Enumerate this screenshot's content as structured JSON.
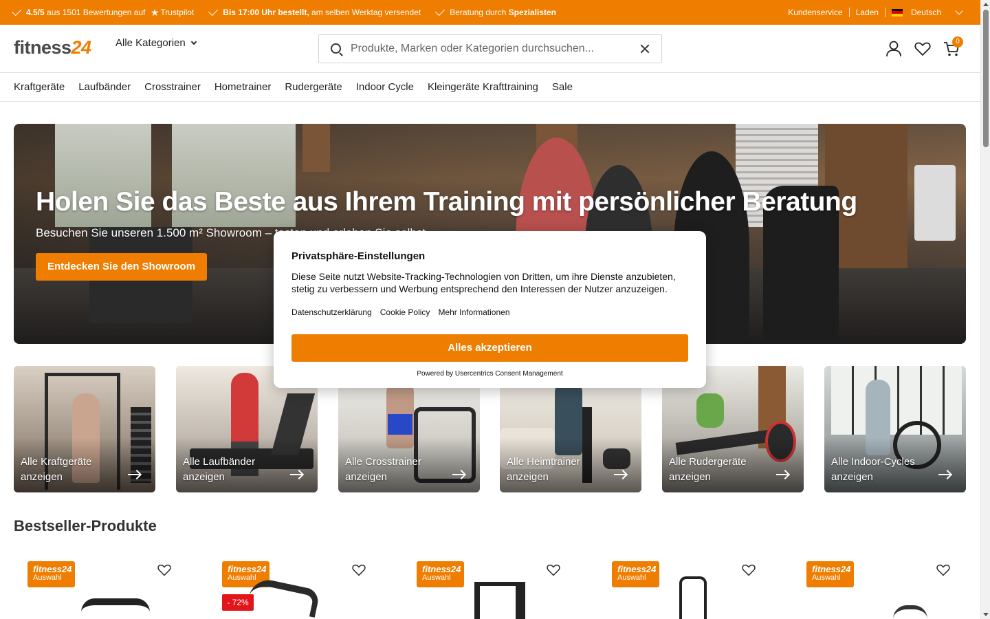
{
  "topbar": {
    "rating_bold": "4.5/5",
    "rating_text": " aus 1501 Bewertungen auf ",
    "rating_brand": "Trustpilot",
    "shipping_bold": "Bis 17:00 Uhr bestellt,",
    "shipping_text": " am selben Werktag versendet",
    "advice_text": "Beratung durch ",
    "advice_bold": "Spezialisten",
    "customer_service": "Kundenservice",
    "store": "Laden",
    "language": "Deutsch"
  },
  "header": {
    "logo_text": "fitness",
    "logo_number": "24",
    "all_categories": "Alle Kategorien",
    "search_placeholder": "Produkte, Marken oder Kategorien durchsuchen...",
    "cart_count": "0"
  },
  "nav": {
    "items": [
      "Kraftgeräte",
      "Laufbänder",
      "Crosstrainer",
      "Hometrainer",
      "Rudergeräte",
      "Indoor Cycle",
      "Kleingeräte Krafttraining",
      "Sale"
    ]
  },
  "hero": {
    "title": "Holen Sie das Beste aus Ihrem Training mit persönlicher Beratung",
    "subtitle": "Besuchen Sie unseren 1.500 m² Showroom – testen und erleben Sie selbst",
    "cta": "Entdecken Sie den Showroom"
  },
  "categories": [
    {
      "label": "Alle Kraftgeräte anzeigen",
      "bg": "#8c7a66"
    },
    {
      "label": "Alle Laufbänder anzeigen",
      "bg": "#b8b0a6"
    },
    {
      "label": "Alle Crosstrainer anzeigen",
      "bg": "#c9c5bd"
    },
    {
      "label": "Alle Heimtrainer anzeigen",
      "bg": "#d8d2c8"
    },
    {
      "label": "Alle Rudergeräte anzeigen",
      "bg": "#b6b2aa"
    },
    {
      "label": "Alle Indoor-Cycles anzeigen",
      "bg": "#9aa2a3"
    }
  ],
  "bestseller_title": "Bestseller-Produkte",
  "products": [
    {
      "badge_brand": "fitness24",
      "badge_label": "Auswahl",
      "discount": ""
    },
    {
      "badge_brand": "fitness24",
      "badge_label": "Auswahl",
      "discount": "- 72%"
    },
    {
      "badge_brand": "fitness24",
      "badge_label": "Auswahl",
      "discount": ""
    },
    {
      "badge_brand": "fitness24",
      "badge_label": "Auswahl",
      "discount": ""
    },
    {
      "badge_brand": "fitness24",
      "badge_label": "Auswahl",
      "discount": ""
    }
  ],
  "consent": {
    "title": "Privatsphäre-Einstellungen",
    "text": "Diese Seite nutzt Website-Tracking-Technologien von Dritten, um ihre Dienste anzubieten, stetig zu verbessern und Werbung entsprechend den Interessen der Nutzer anzuzeigen.",
    "links": [
      "Datenschutzerklärung",
      "Cookie Policy",
      "Mehr Informationen"
    ],
    "accept": "Alles akzeptieren",
    "powered": "Powered by Usercentrics Consent Management"
  },
  "colors": {
    "accent": "#ef7d00",
    "discount": "#e3151a"
  },
  "icons": [
    "check-icon",
    "star-icon",
    "flag-de-icon",
    "chevron-down-icon",
    "search-icon",
    "clear-icon",
    "user-icon",
    "heart-icon",
    "cart-icon",
    "arrow-right-icon"
  ]
}
